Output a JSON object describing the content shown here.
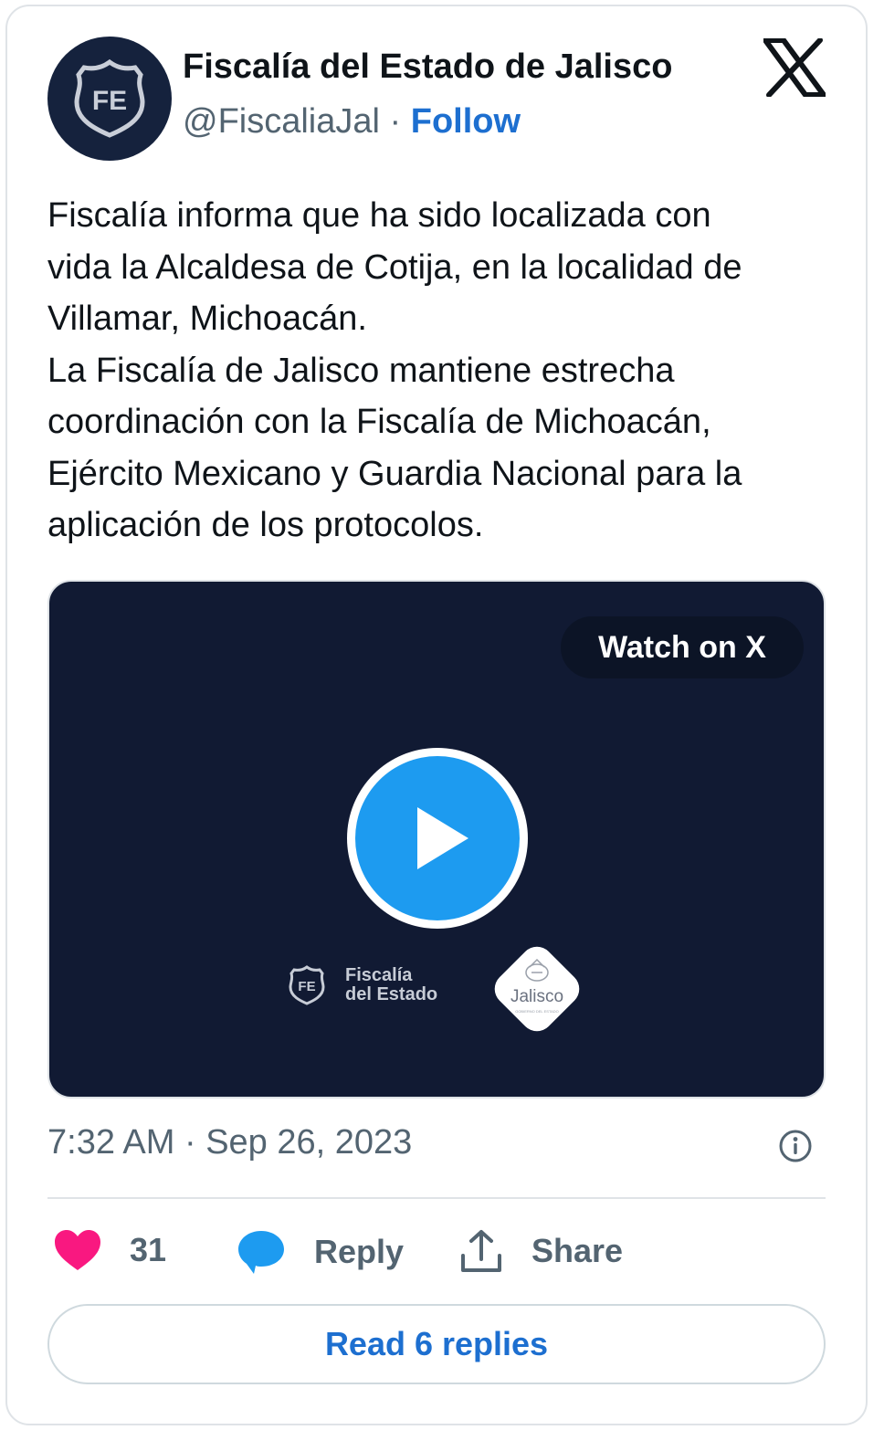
{
  "account": {
    "name": "Fiscalía del Estado de Jalisco",
    "handle": "@FiscaliaJal",
    "separator": "·",
    "follow_label": "Follow",
    "avatar_text": "FE"
  },
  "tweet": {
    "text": "Fiscalía informa que ha sido localizada con\nvida la Alcaldesa de Cotija, en la localidad de\nVillamar, Michoacán.\nLa Fiscalía de Jalisco mantiene estrecha\ncoordinación con la Fiscalía de Michoacán,\nEjército Mexicano y Guardia Nacional para la\naplicación de los protocolos.",
    "timestamp": "7:32 AM · Sep 26, 2023"
  },
  "media": {
    "watch_label": "Watch on X",
    "brand_badge": "FE",
    "brand_line1": "Fiscalía",
    "brand_line2": "del Estado",
    "partner_logo": "Jalisco",
    "partner_subtext": "GOBIERNO DEL ESTADO"
  },
  "actions": {
    "likes": "31",
    "reply_label": "Reply",
    "share_label": "Share",
    "read_replies_label": "Read 6 replies"
  },
  "colors": {
    "accent": "#1d6fd0",
    "play": "#1d9bf0",
    "like": "#f91880",
    "media_bg": "#111a33",
    "avatar_bg": "#15223d"
  },
  "icons": [
    "x-logo-icon",
    "play-icon",
    "info-icon",
    "heart-icon",
    "reply-bubble-icon",
    "share-icon"
  ]
}
